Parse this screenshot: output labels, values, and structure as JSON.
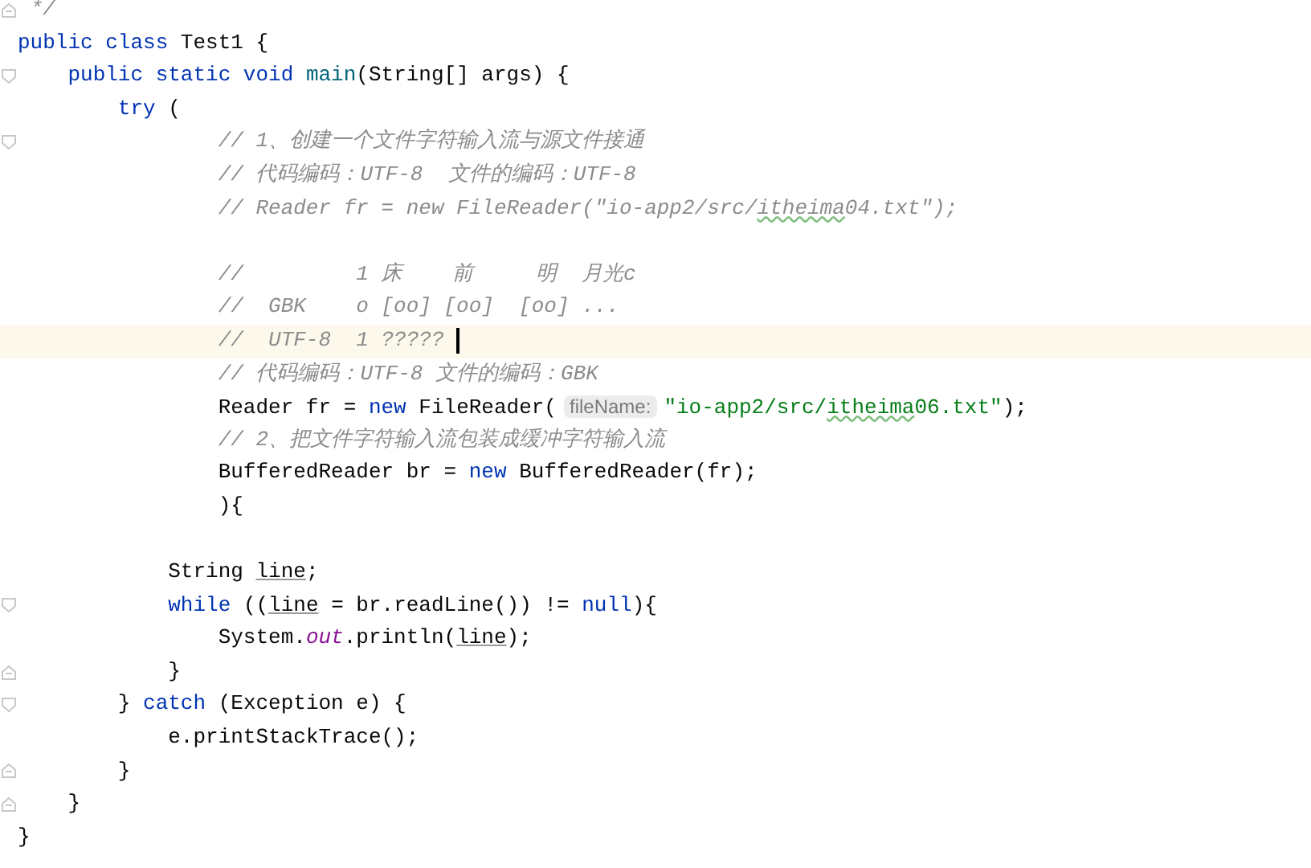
{
  "editor": {
    "lines": [
      {
        "current": false,
        "fold_open": false,
        "fold_close": true,
        "tokens": [
          {
            "kind": "comment",
            "text": " */"
          }
        ]
      },
      {
        "current": false,
        "fold_open": false,
        "fold_close": false,
        "tokens": [
          {
            "kind": "keyword",
            "text": "public class "
          },
          {
            "kind": "plain",
            "text": "Test1 {"
          }
        ]
      },
      {
        "current": false,
        "fold_open": true,
        "fold_close": false,
        "tokens": [
          {
            "kind": "keyword",
            "text": "    public static void "
          },
          {
            "kind": "method",
            "text": "main"
          },
          {
            "kind": "plain",
            "text": "(String[] args) {"
          }
        ]
      },
      {
        "current": false,
        "fold_open": false,
        "fold_close": false,
        "tokens": [
          {
            "kind": "keyword",
            "text": "        try "
          },
          {
            "kind": "plain",
            "text": "("
          }
        ]
      },
      {
        "current": false,
        "fold_open": true,
        "fold_close": false,
        "tokens": [
          {
            "kind": "comment",
            "text": "                // 1、创建一个文件字符输入流与源文件接通"
          }
        ]
      },
      {
        "current": false,
        "fold_open": false,
        "fold_close": false,
        "tokens": [
          {
            "kind": "comment",
            "text": "                // 代码编码：UTF-8  文件的编码：UTF-8"
          }
        ]
      },
      {
        "current": false,
        "fold_open": false,
        "fold_close": false,
        "tokens": [
          {
            "kind": "comment",
            "text": "                // Reader fr = new FileReader(\"io-app2/src/"
          },
          {
            "kind": "comment_typo",
            "text": "itheima"
          },
          {
            "kind": "comment",
            "text": "04.txt\");"
          }
        ]
      },
      {
        "current": false,
        "fold_open": false,
        "fold_close": false
      },
      {
        "current": false,
        "fold_open": false,
        "fold_close": false,
        "tokens": [
          {
            "kind": "comment",
            "text": "                //         1 床    前     明  月光c"
          }
        ]
      },
      {
        "current": false,
        "fold_open": false,
        "fold_close": false,
        "tokens": [
          {
            "kind": "comment",
            "text": "                //  GBK    o [oo] [oo]  [oo] ..."
          }
        ]
      },
      {
        "current": true,
        "fold_open": false,
        "fold_close": false,
        "tokens": [
          {
            "kind": "comment",
            "text": "                //  UTF-8  1 ????? "
          }
        ]
      },
      {
        "current": false,
        "fold_open": false,
        "fold_close": false,
        "tokens": [
          {
            "kind": "comment",
            "text": "                // 代码编码：UTF-8 文件的编码：GBK"
          }
        ]
      },
      {
        "current": false,
        "fold_open": false,
        "fold_close": false,
        "tokens": [
          {
            "kind": "plain",
            "text": "                Reader fr = "
          },
          {
            "kind": "keyword",
            "text": "new "
          },
          {
            "kind": "plain",
            "text": "FileReader("
          },
          {
            "kind": "hint",
            "text": "fileName:"
          },
          {
            "kind": "string",
            "text": "\"io-app2/src/"
          },
          {
            "kind": "string_typo",
            "text": "itheima"
          },
          {
            "kind": "string",
            "text": "06.txt\""
          },
          {
            "kind": "plain",
            "text": ");"
          }
        ]
      },
      {
        "current": false,
        "fold_open": false,
        "fold_close": false,
        "tokens": [
          {
            "kind": "comment",
            "text": "                // 2、把文件字符输入流包装成缓冲字符输入流"
          }
        ]
      },
      {
        "current": false,
        "fold_open": false,
        "fold_close": false,
        "tokens": [
          {
            "kind": "plain",
            "text": "                BufferedReader br = "
          },
          {
            "kind": "keyword",
            "text": "new "
          },
          {
            "kind": "plain",
            "text": "BufferedReader(fr);"
          }
        ]
      },
      {
        "current": false,
        "fold_open": false,
        "fold_close": false,
        "tokens": [
          {
            "kind": "plain",
            "text": "                ){"
          }
        ]
      },
      {
        "current": false,
        "fold_open": false,
        "fold_close": false
      },
      {
        "current": false,
        "fold_open": false,
        "fold_close": false,
        "tokens": [
          {
            "kind": "plain",
            "text": "            String "
          },
          {
            "kind": "var",
            "text": "line"
          },
          {
            "kind": "plain",
            "text": ";"
          }
        ]
      },
      {
        "current": false,
        "fold_open": true,
        "fold_close": false,
        "tokens": [
          {
            "kind": "keyword",
            "text": "            while "
          },
          {
            "kind": "plain",
            "text": "(("
          },
          {
            "kind": "var",
            "text": "line"
          },
          {
            "kind": "plain",
            "text": " = br.readLine()) != "
          },
          {
            "kind": "keyword",
            "text": "null"
          },
          {
            "kind": "plain",
            "text": "){"
          }
        ]
      },
      {
        "current": false,
        "fold_open": false,
        "fold_close": false,
        "tokens": [
          {
            "kind": "plain",
            "text": "                System."
          },
          {
            "kind": "field",
            "text": "out"
          },
          {
            "kind": "plain",
            "text": ".println("
          },
          {
            "kind": "var",
            "text": "line"
          },
          {
            "kind": "plain",
            "text": ");"
          }
        ]
      },
      {
        "current": false,
        "fold_open": false,
        "fold_close": true,
        "tokens": [
          {
            "kind": "plain",
            "text": "            }"
          }
        ]
      },
      {
        "current": false,
        "fold_open": true,
        "fold_close": false,
        "tokens": [
          {
            "kind": "plain",
            "text": "        } "
          },
          {
            "kind": "keyword",
            "text": "catch "
          },
          {
            "kind": "plain",
            "text": "(Exception e) {"
          }
        ]
      },
      {
        "current": false,
        "fold_open": false,
        "fold_close": false,
        "tokens": [
          {
            "kind": "plain",
            "text": "            e.printStackTrace();"
          }
        ]
      },
      {
        "current": false,
        "fold_open": false,
        "fold_close": true,
        "tokens": [
          {
            "kind": "plain",
            "text": "        }"
          }
        ]
      },
      {
        "current": false,
        "fold_open": false,
        "fold_close": true,
        "tokens": [
          {
            "kind": "plain",
            "text": "    }"
          }
        ]
      },
      {
        "current": false,
        "fold_open": false,
        "fold_close": false,
        "tokens": [
          {
            "kind": "plain",
            "text": "}"
          }
        ]
      }
    ]
  }
}
